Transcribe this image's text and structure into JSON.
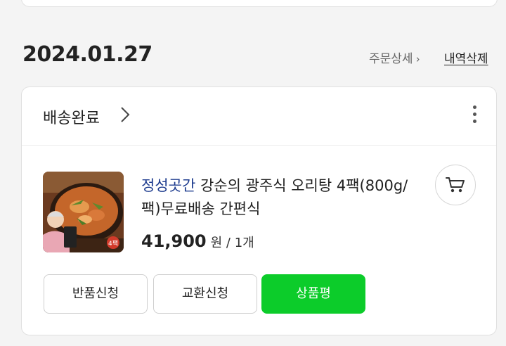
{
  "order": {
    "date": "2024.01.27",
    "detail_link": "주문상세",
    "delete_link": "내역삭제",
    "status": "배송완료",
    "product": {
      "brand": "정성곳간",
      "name": " 강순의 광주식 오리탕 4팩(800g/팩)무료배송 간편식",
      "price": "41,900",
      "price_unit": "원 / 1개",
      "thumbnail_badge": "4팩"
    },
    "buttons": {
      "return": "반품신청",
      "exchange": "교환신청",
      "review": "상품평"
    }
  },
  "colors": {
    "accent_green": "#0ccc2a",
    "brand_blue": "#1f3d8f"
  },
  "icons": [
    "chevron-right-icon",
    "kebab-menu-icon",
    "cart-icon"
  ]
}
